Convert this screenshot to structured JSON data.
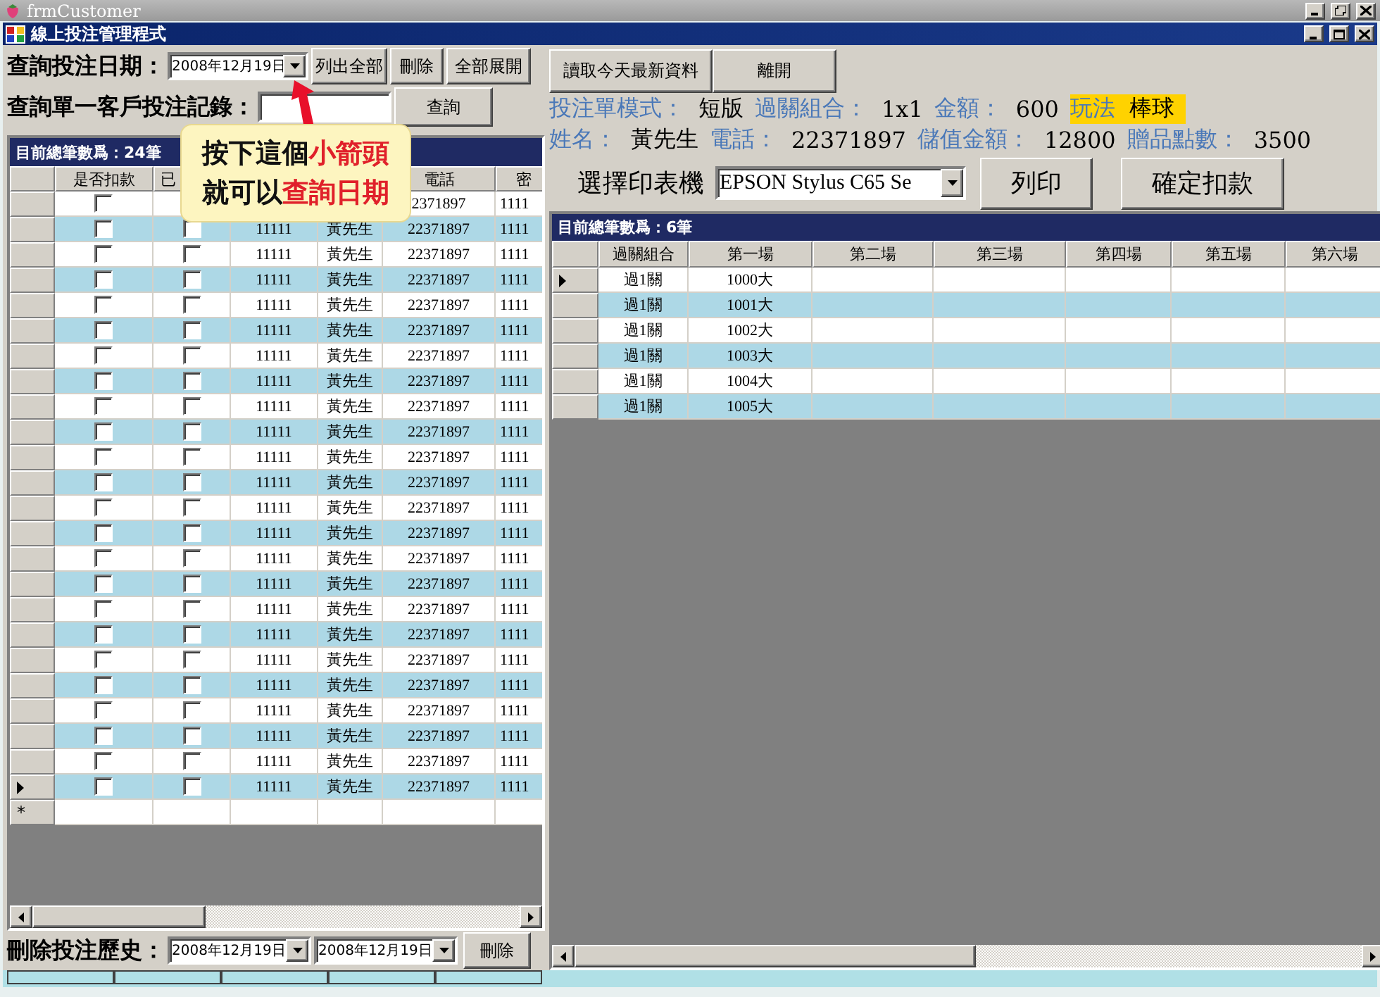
{
  "outer_window": {
    "title": "frmCustomer"
  },
  "window": {
    "title": "線上投注管理程式"
  },
  "date_query": {
    "label": "查詢投注日期：",
    "date": "2008年12月19日",
    "buttons": [
      "列出全部",
      "刪除",
      "全部展開"
    ]
  },
  "customer_query": {
    "label": "查詢單一客戶投注記錄：",
    "button": "查詢"
  },
  "orders_table": {
    "caption": "目前總筆數爲：24筆",
    "columns": [
      {
        "kind": "check",
        "header": "是否扣款"
      },
      {
        "kind": "check",
        "header": "已"
      },
      {
        "kind": "text"
      },
      {
        "kind": "text"
      },
      {
        "kind": "text",
        "header": "電話"
      },
      {
        "kind": "text",
        "header": "密"
      }
    ],
    "rows": [
      {
        "selected": false,
        "cells": [
          {
            "checked": false
          },
          null,
          null,
          null,
          "2371897",
          "1111"
        ]
      },
      {
        "selected": false,
        "cells": [
          {
            "checked": false
          },
          {
            "checked": false
          },
          "11111",
          "黃先生",
          "22371897",
          "1111"
        ]
      },
      {
        "selected": false,
        "cells": [
          {
            "checked": false
          },
          {
            "checked": false
          },
          "11111",
          "黃先生",
          "22371897",
          "1111"
        ]
      },
      {
        "selected": false,
        "cells": [
          {
            "checked": false
          },
          {
            "checked": false
          },
          "11111",
          "黃先生",
          "22371897",
          "1111"
        ]
      },
      {
        "selected": false,
        "cells": [
          {
            "checked": false
          },
          {
            "checked": false
          },
          "11111",
          "黃先生",
          "22371897",
          "1111"
        ]
      },
      {
        "selected": false,
        "cells": [
          {
            "checked": false
          },
          {
            "checked": false
          },
          "11111",
          "黃先生",
          "22371897",
          "1111"
        ]
      },
      {
        "selected": false,
        "cells": [
          {
            "checked": false
          },
          {
            "checked": false
          },
          "11111",
          "黃先生",
          "22371897",
          "1111"
        ]
      },
      {
        "selected": false,
        "cells": [
          {
            "checked": false
          },
          {
            "checked": false
          },
          "11111",
          "黃先生",
          "22371897",
          "1111"
        ]
      },
      {
        "selected": false,
        "cells": [
          {
            "checked": false
          },
          {
            "checked": false
          },
          "11111",
          "黃先生",
          "22371897",
          "1111"
        ]
      },
      {
        "selected": false,
        "cells": [
          {
            "checked": false
          },
          {
            "checked": false
          },
          "11111",
          "黃先生",
          "22371897",
          "1111"
        ]
      },
      {
        "selected": false,
        "cells": [
          {
            "checked": false
          },
          {
            "checked": false
          },
          "11111",
          "黃先生",
          "22371897",
          "1111"
        ]
      },
      {
        "selected": false,
        "cells": [
          {
            "checked": false
          },
          {
            "checked": false
          },
          "11111",
          "黃先生",
          "22371897",
          "1111"
        ]
      },
      {
        "selected": false,
        "cells": [
          {
            "checked": false
          },
          {
            "checked": false
          },
          "11111",
          "黃先生",
          "22371897",
          "1111"
        ]
      },
      {
        "selected": false,
        "cells": [
          {
            "checked": false
          },
          {
            "checked": false
          },
          "11111",
          "黃先生",
          "22371897",
          "1111"
        ]
      },
      {
        "selected": false,
        "cells": [
          {
            "checked": false
          },
          {
            "checked": false
          },
          "11111",
          "黃先生",
          "22371897",
          "1111"
        ]
      },
      {
        "selected": false,
        "cells": [
          {
            "checked": false
          },
          {
            "checked": false
          },
          "11111",
          "黃先生",
          "22371897",
          "1111"
        ]
      },
      {
        "selected": false,
        "cells": [
          {
            "checked": false
          },
          {
            "checked": false
          },
          "11111",
          "黃先生",
          "22371897",
          "1111"
        ]
      },
      {
        "selected": false,
        "cells": [
          {
            "checked": false
          },
          {
            "checked": false
          },
          "11111",
          "黃先生",
          "22371897",
          "1111"
        ]
      },
      {
        "selected": false,
        "cells": [
          {
            "checked": false
          },
          {
            "checked": false
          },
          "11111",
          "黃先生",
          "22371897",
          "1111"
        ]
      },
      {
        "selected": false,
        "cells": [
          {
            "checked": false
          },
          {
            "checked": false
          },
          "11111",
          "黃先生",
          "22371897",
          "1111"
        ]
      },
      {
        "selected": false,
        "cells": [
          {
            "checked": false
          },
          {
            "checked": false
          },
          "11111",
          "黃先生",
          "22371897",
          "1111"
        ]
      },
      {
        "selected": false,
        "cells": [
          {
            "checked": false
          },
          {
            "checked": false
          },
          "11111",
          "黃先生",
          "22371897",
          "1111"
        ]
      },
      {
        "selected": false,
        "cells": [
          {
            "checked": false
          },
          {
            "checked": false
          },
          "11111",
          "黃先生",
          "22371897",
          "1111"
        ]
      },
      {
        "selected": true,
        "cells": [
          {
            "checked": false
          },
          {
            "checked": false
          },
          "11111",
          "黃先生",
          "22371897",
          "1111"
        ]
      }
    ],
    "new_row_marker": "*"
  },
  "delete_history": {
    "label": "刪除投注歷史：",
    "from": "2008年12月19日",
    "to": "2008年12月19日",
    "button": "刪除"
  },
  "top_buttons": [
    "讀取今天最新資料",
    "離開"
  ],
  "ticket_info": [
    [
      {
        "label": "投注單模式：",
        "value": "短版",
        "highlighted": false
      },
      {
        "label": "過關組合：",
        "value": "1x1",
        "highlighted": false
      },
      {
        "label": "金額：",
        "value": "600",
        "highlighted": false
      },
      {
        "label": "玩法",
        "value": "棒球",
        "highlighted": true
      }
    ],
    [
      {
        "label": "姓名：",
        "value": "黃先生",
        "highlighted": false
      },
      {
        "label": "電話：",
        "value": "22371897",
        "highlighted": false
      },
      {
        "label": "儲值金額：",
        "value": "12800",
        "highlighted": false
      },
      {
        "label": "贈品點數：",
        "value": "3500",
        "highlighted": false
      }
    ]
  ],
  "printer": {
    "label": "選擇印表機",
    "selected_printer": "EPSON Stylus C65 Se",
    "buttons": [
      "列印",
      "確定扣款"
    ]
  },
  "bets_table": {
    "caption": "目前總筆數爲：6筆",
    "columns": [
      "過關組合",
      "第一場",
      "第二場",
      "第三場",
      "第四場",
      "第五場",
      "第六場"
    ],
    "rows": [
      {
        "selected": true,
        "cells": [
          "過1關",
          "1000大"
        ]
      },
      {
        "selected": false,
        "cells": [
          "過1關",
          "1001大"
        ]
      },
      {
        "selected": false,
        "cells": [
          "過1關",
          "1002大"
        ]
      },
      {
        "selected": false,
        "cells": [
          "過1關",
          "1003大"
        ]
      },
      {
        "selected": false,
        "cells": [
          "過1關",
          "1004大"
        ]
      },
      {
        "selected": false,
        "cells": [
          "過1關",
          "1005大"
        ]
      }
    ]
  },
  "callout": {
    "lines": [
      [
        {
          "text": "按下這個",
          "emphasis": false
        },
        {
          "text": "小箭頭",
          "emphasis": true
        }
      ],
      [
        {
          "text": "就可以",
          "emphasis": false
        },
        {
          "text": "查詢日期",
          "emphasis": true
        }
      ]
    ]
  }
}
